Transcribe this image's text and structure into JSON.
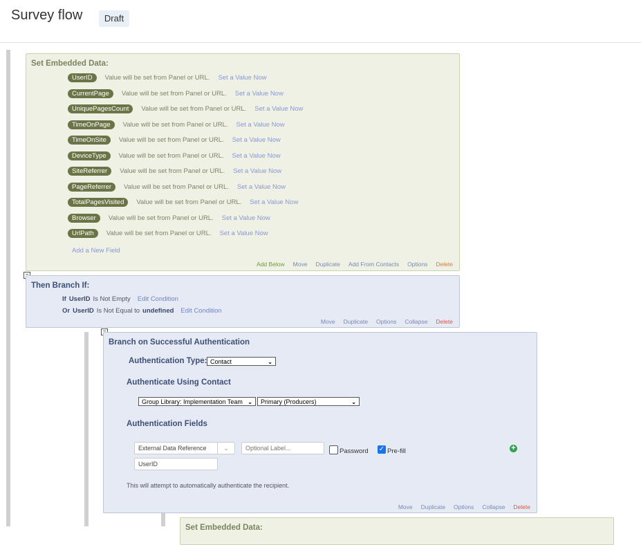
{
  "header": {
    "title": "Survey flow",
    "badge": "Draft"
  },
  "embedded": {
    "title": "Set Embedded Data:",
    "fields": [
      {
        "name": "UserID",
        "desc": "Value will be set from Panel or URL.",
        "link": "Set a Value Now"
      },
      {
        "name": "CurrentPage",
        "desc": "Value will be set from Panel or URL.",
        "link": "Set a Value Now"
      },
      {
        "name": "UniquePagesCount",
        "desc": "Value will be set from Panel or URL.",
        "link": "Set a Value Now"
      },
      {
        "name": "TimeOnPage",
        "desc": "Value will be set from Panel or URL.",
        "link": "Set a Value Now"
      },
      {
        "name": "TimeOnSite",
        "desc": "Value will be set from Panel or URL.",
        "link": "Set a Value Now"
      },
      {
        "name": "DeviceType",
        "desc": "Value will be set from Panel or URL.",
        "link": "Set a Value Now"
      },
      {
        "name": "SiteReferrer",
        "desc": "Value will be set from Panel or URL.",
        "link": "Set a Value Now"
      },
      {
        "name": "PageReferrer",
        "desc": "Value will be set from Panel or URL.",
        "link": "Set a Value Now"
      },
      {
        "name": "TotalPagesVisited",
        "desc": "Value will be set from Panel or URL.",
        "link": "Set a Value Now"
      },
      {
        "name": "Browser",
        "desc": "Value will be set from Panel or URL.",
        "link": "Set a Value Now"
      },
      {
        "name": "UrlPath",
        "desc": "Value will be set from Panel or URL.",
        "link": "Set a Value Now"
      }
    ],
    "add_field": "Add a New Field",
    "actions": {
      "add_below": "Add Below",
      "move": "Move",
      "duplicate": "Duplicate",
      "add_from_contacts": "Add From Contacts",
      "options": "Options",
      "delete": "Delete"
    }
  },
  "branch": {
    "title": "Then Branch If:",
    "conditions": [
      {
        "conj": "If",
        "field": "UserID",
        "op": "Is Not Empty",
        "value": "",
        "edit": "Edit Condition"
      },
      {
        "conj": "Or",
        "field": "UserID",
        "op": "Is Not Equal to",
        "value": "undefined",
        "edit": "Edit Condition"
      }
    ],
    "actions": {
      "move": "Move",
      "duplicate": "Duplicate",
      "options": "Options",
      "collapse": "Collapse",
      "delete": "Delete"
    }
  },
  "auth": {
    "title": "Branch on Successful Authentication",
    "type_label": "Authentication Type:",
    "type_value": "Contact",
    "using_label": "Authenticate Using Contact",
    "library": "Group Library: Implementation Team",
    "list": "Primary (Producers)",
    "fields_label": "Authentication Fields",
    "field_type": "External Data Reference",
    "optional_label_placeholder": "Optional Label...",
    "password_label": "Password",
    "password_checked": false,
    "prefill_label": "Pre-fill",
    "prefill_checked": true,
    "field_value": "UserID",
    "note": "This will attempt to automatically authenticate the recipient.",
    "actions": {
      "move": "Move",
      "duplicate": "Duplicate",
      "options": "Options",
      "collapse": "Collapse",
      "delete": "Delete"
    }
  },
  "embedded2": {
    "title": "Set Embedded Data:"
  }
}
